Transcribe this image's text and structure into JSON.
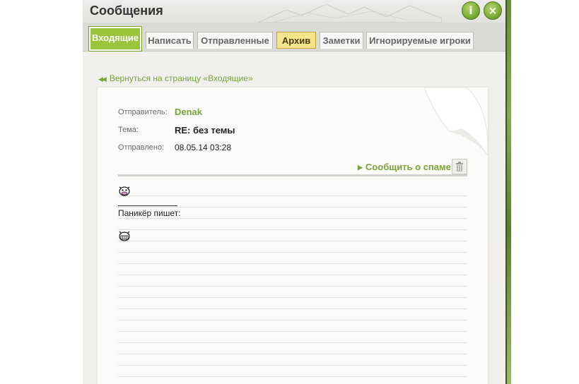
{
  "window": {
    "title": "Сообщения",
    "info_button": "i",
    "close_button": "×"
  },
  "tabs": [
    {
      "label": "Входящие",
      "active": true
    },
    {
      "label": "Написать"
    },
    {
      "label": "Отправленные"
    },
    {
      "label": "Архив",
      "highlighted": true
    },
    {
      "label": "Заметки"
    },
    {
      "label": "Игнорируемые игроки"
    }
  ],
  "back_link": "Вернуться на страницу «Входящие»",
  "message": {
    "sender_label": "Отправитель:",
    "sender": "Denak",
    "subject_label": "Тема:",
    "subject": "RE: без темы",
    "sent_label": "Отправлено:",
    "sent": "08.05.14 03:28",
    "spam_label": "Сообщить о спаме",
    "quote_text": "Паникёр пишет:"
  },
  "colors": {
    "accent_green": "#7aa33a",
    "active_tab": "#9ac43b",
    "archive_tab": "#f4e48b"
  },
  "icons": [
    "info-icon",
    "close-icon",
    "double-arrow-left-icon",
    "triangle-right-icon",
    "trash-icon",
    "cow-smiley-icon",
    "grin-smiley-icon"
  ]
}
